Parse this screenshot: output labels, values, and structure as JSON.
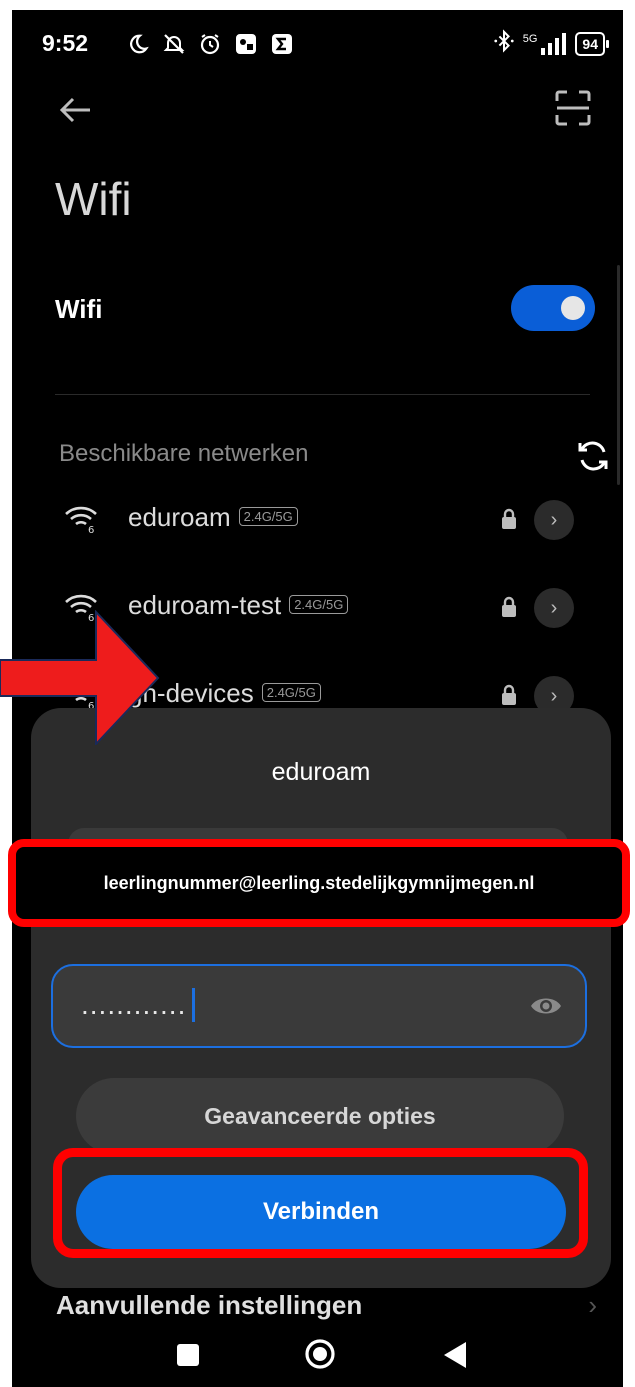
{
  "status_bar": {
    "time": "9:52",
    "network_label": "5G",
    "battery": "94"
  },
  "page": {
    "title": "Wifi",
    "wifi_label": "Wifi",
    "wifi_enabled": true,
    "available_label": "Beschikbare netwerken"
  },
  "networks": [
    {
      "name": "eduroam",
      "band": "2.4G/5G",
      "secured": true,
      "icon": "wifi-6-icon"
    },
    {
      "name": "eduroam-test",
      "band": "2.4G/5G",
      "secured": true,
      "icon": "wifi-6-icon"
    },
    {
      "name": "gn-devices",
      "band": "2.4G/5G",
      "secured": true,
      "icon": "wifi-6-icon"
    }
  ],
  "dialog": {
    "title": "eduroam",
    "identity_value": "leerlingnummer@leerling.stedelijkgymnijmegen.nl",
    "password_value": "............",
    "advanced_label": "Geavanceerde opties",
    "connect_label": "Verbinden"
  },
  "footer": {
    "extra_settings_label": "Aanvullende instellingen"
  },
  "colors": {
    "accent": "#0b70e2",
    "annotation": "#ff0000",
    "background": "#000000",
    "sheet": "#2c2c2c"
  }
}
